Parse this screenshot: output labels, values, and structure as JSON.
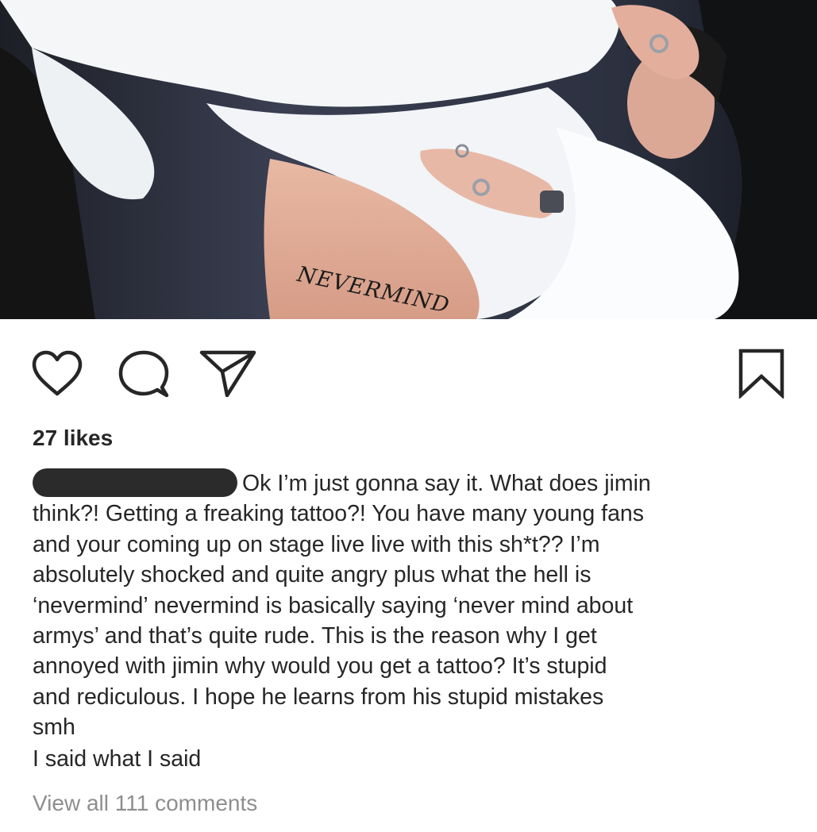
{
  "photo": {
    "tattoo_text": "NEVERMIND"
  },
  "actions": {
    "like_icon": "heart-outline",
    "comment_icon": "speech-bubble-outline",
    "share_icon": "paper-plane-outline",
    "save_icon": "bookmark-outline"
  },
  "post": {
    "likes": "27 likes",
    "caption_lines": [
      "Ok I’m just gonna say it. What does jimin",
      "think?! Getting a freaking tattoo?! You have many young fans",
      "and your coming up on stage live live with this sh*t?? I’m",
      "absolutely shocked and quite angry plus what the hell is",
      "‘nevermind’ nevermind is basically saying ‘never mind about",
      "armys’ and that’s quite rude. This is the reason why I get",
      "annoyed with jimin why would you get a tattoo? It’s stupid",
      "and rediculous. I hope he learns from his stupid mistakes",
      "smh"
    ],
    "reply": "I said what I said",
    "view_comments": "View all 111 comments"
  },
  "colors": {
    "text": "#262626",
    "muted": "#8e8e8e",
    "redaction": "#2b2b2b"
  }
}
